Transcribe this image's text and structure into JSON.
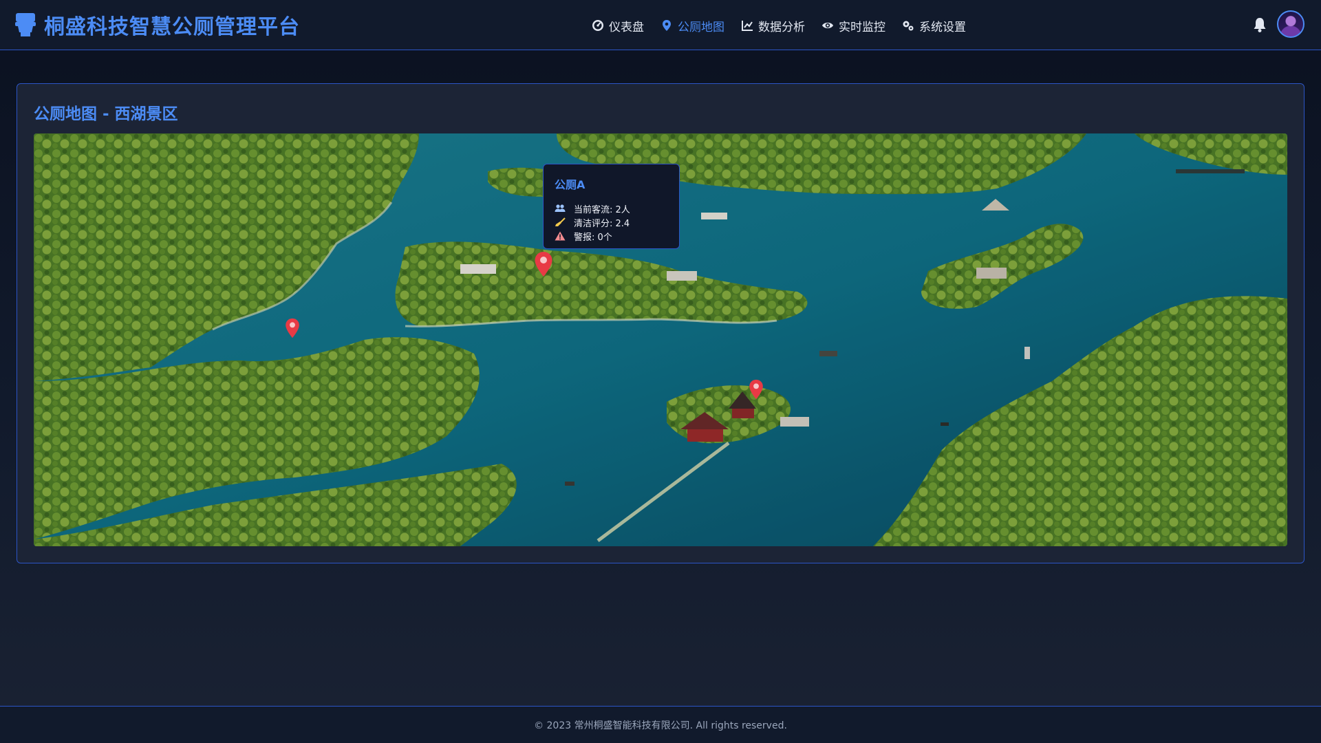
{
  "header": {
    "brand_title": "桐盛科技智慧公厕管理平台",
    "nav": [
      {
        "label": "仪表盘",
        "icon": "gauge-icon",
        "active": false
      },
      {
        "label": "公厕地图",
        "icon": "map-marker-icon",
        "active": true
      },
      {
        "label": "数据分析",
        "icon": "line-chart-icon",
        "active": false
      },
      {
        "label": "实时监控",
        "icon": "eye-icon",
        "active": false
      },
      {
        "label": "系统设置",
        "icon": "gears-icon",
        "active": false
      }
    ],
    "notification_icon": "bell-icon",
    "avatar_icon": "user-avatar"
  },
  "map_panel": {
    "title": "公厕地图 - 西湖景区",
    "markers": [
      {
        "name": "公厕A",
        "selected": true
      },
      {
        "name": "",
        "selected": false
      },
      {
        "name": "",
        "selected": false
      }
    ],
    "popup": {
      "title": "公厕A",
      "rows": [
        {
          "icon": "users-icon",
          "text": "当前客流: 2人"
        },
        {
          "icon": "broom-icon",
          "text": "清洁评分: 2.4"
        },
        {
          "icon": "warning-icon",
          "text": "警报: 0个"
        }
      ]
    }
  },
  "footer": {
    "copyright": "© 2023 常州桐盛智能科技有限公司. All rights reserved."
  },
  "colors": {
    "accent": "#4c8cf5",
    "marker": "#e83a45",
    "page_bg": "#111a2c",
    "card_bg": "#1c2436"
  }
}
